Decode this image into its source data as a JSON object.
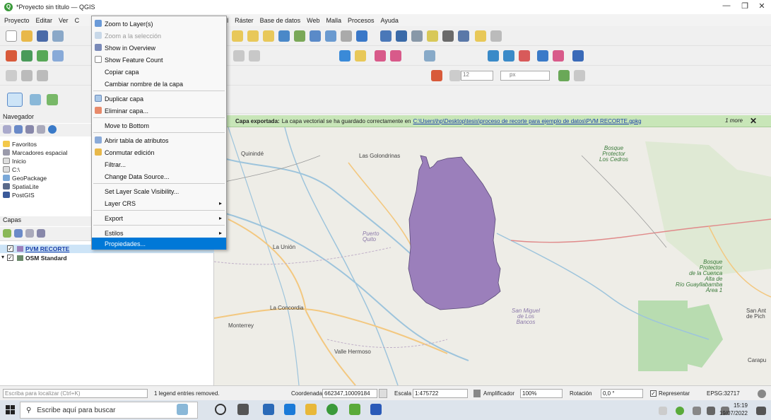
{
  "window": {
    "title": "*Proyecto sin título — QGIS",
    "minimize": "—",
    "restore": "❐",
    "close": "✕"
  },
  "menubar": {
    "items": [
      "Proyecto",
      "Editar",
      "Ver",
      "C",
      "grial",
      "Ráster",
      "Base de datos",
      "Web",
      "Malla",
      "Procesos",
      "Ayuda"
    ]
  },
  "navigator": {
    "title": "Navegador",
    "items": [
      "Favoritos",
      "Marcadores espacial",
      "Inicio",
      "C:\\",
      "GeoPackage",
      "SpatiaLite",
      "PostGIS"
    ]
  },
  "layers": {
    "title": "Capas",
    "items": [
      {
        "name": "PVM RECORTE",
        "checked": true
      },
      {
        "name": "OSM Standard",
        "checked": true
      }
    ]
  },
  "message": {
    "bold": "Capa exportada:",
    "text": "La capa vectorial se ha guardado correctamente en",
    "link": "C:\\Users\\hp\\Desktop\\tesis\\proceso de recorte para ejemplo de datos\\PVM RECORTE.gpkg",
    "more": "1 more",
    "close": "✕"
  },
  "context_menu": {
    "items": [
      {
        "label": "Zoom to Layer(s)",
        "state": "normal",
        "icon": "zoom-layer-icon"
      },
      {
        "label": "Zoom a la selección",
        "state": "disabled",
        "icon": "zoom-selection-icon"
      },
      {
        "label": "Show in Overview",
        "state": "normal",
        "icon": "overview-icon"
      },
      {
        "label": "Show Feature Count",
        "state": "normal",
        "icon": "checkbox-icon"
      },
      {
        "label": "Copiar capa",
        "state": "normal",
        "icon": ""
      },
      {
        "label": "Cambiar nombre de la capa",
        "state": "normal",
        "icon": ""
      },
      {
        "label": "Duplicar capa",
        "state": "normal",
        "icon": "duplicate-icon"
      },
      {
        "label": "Eliminar capa...",
        "state": "normal",
        "icon": "delete-icon"
      },
      {
        "label": "Move to Bottom",
        "state": "normal",
        "icon": ""
      },
      {
        "label": "Abrir tabla de atributos",
        "state": "normal",
        "icon": "table-icon"
      },
      {
        "label": "Conmutar edición",
        "state": "normal",
        "icon": "pencil-icon"
      },
      {
        "label": "Filtrar...",
        "state": "normal",
        "icon": ""
      },
      {
        "label": "Change Data Source...",
        "state": "normal",
        "icon": ""
      },
      {
        "label": "Set Layer Scale Visibility...",
        "state": "normal",
        "icon": ""
      },
      {
        "label": "Layer CRS",
        "state": "normal",
        "icon": "",
        "submenu": true
      },
      {
        "label": "Export",
        "state": "normal",
        "icon": "",
        "submenu": true
      },
      {
        "label": "Estilos",
        "state": "normal",
        "icon": "",
        "submenu": true
      },
      {
        "label": "Propiedades...",
        "state": "selected",
        "icon": ""
      }
    ]
  },
  "map": {
    "labels": {
      "quininde": "Quinindé",
      "golondrinas": "Las Golondrinas",
      "bosque1": "Bosque\nProtector\nLos Cedros",
      "puerto": "Puerto\nQuito",
      "launion": "La Unión",
      "laconcordia": "La Concordia",
      "monterrey": "Monterrey",
      "vallehermoso": "Valle Hermoso",
      "sanmiguel": "San Miguel\nde Los\nBancos",
      "bosque2": "Bosque\nProtector\nde la Cuenca\nAlta de\nRío Guayllabamba\nÁrea 1",
      "sanan": "San Ant\nde Pich",
      "carapu": "Carapu"
    },
    "polygon_color": "#9b7fbb",
    "water_color": "#9dc4dc",
    "road_color": "#f3c880",
    "forest_color": "#b8dcb0"
  },
  "status": {
    "locate_placeholder": "Escriba para localizar (Ctrl+K)",
    "legend_msg": "1 legend entries removed.",
    "coord_label": "Coordenada",
    "coord_value": "662347,10009184",
    "scale_label": "Escala",
    "scale_value": "1:475722",
    "magnifier_label": "Amplificador",
    "magnifier_value": "100%",
    "rotation_label": "Rotación",
    "rotation_value": "0,0 °",
    "render_label": "Representar",
    "crs": "EPSG:32717"
  },
  "taskbar": {
    "search_placeholder": "Escribe aquí para buscar",
    "time": "15:19",
    "date": "19/07/2022"
  }
}
